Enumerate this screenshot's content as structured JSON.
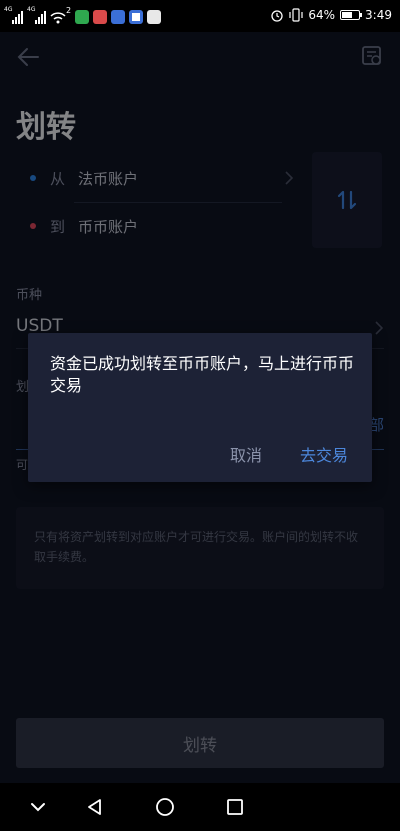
{
  "status_bar": {
    "sim1_tag": "4G",
    "sim2_tag": "4G",
    "wifi_badge": "2",
    "alarm_icon": "alarm-icon",
    "vibrate_icon": "vibrate-icon",
    "battery_percent": "64%",
    "battery_level": 0.64,
    "time": "3:49"
  },
  "header": {
    "back_icon": "arrow-left-icon",
    "record_icon": "transfer-record-icon",
    "title": "划转"
  },
  "accounts": {
    "from_label": "从",
    "from_value": "法币账户",
    "to_label": "到",
    "to_value": "币币账户",
    "from_dot_color": "#2c86e8",
    "to_dot_color": "#e0485d",
    "swap_icon": "swap-arrows-icon"
  },
  "coin": {
    "label": "币种",
    "value": "USDT"
  },
  "amount": {
    "label": "划",
    "all_label": "部",
    "available_label": "可"
  },
  "notice": {
    "text": "只有将资产划转到对应账户才可进行交易。账户间的划转不收取手续费。"
  },
  "submit": {
    "label": "划转"
  },
  "dialog": {
    "message": "资金已成功划转至币币账户，马上进行币币交易",
    "cancel_label": "取消",
    "confirm_label": "去交易"
  },
  "nav_bar": {
    "back_icon": "nav-back-triangle-icon",
    "home_icon": "nav-home-circle-icon",
    "recents_icon": "nav-recents-square-icon",
    "collapse_icon": "nav-collapse-chevron-icon"
  },
  "colors": {
    "accent": "#4c87db",
    "page_bg": "#101424",
    "dialog_bg": "#1d2236"
  }
}
